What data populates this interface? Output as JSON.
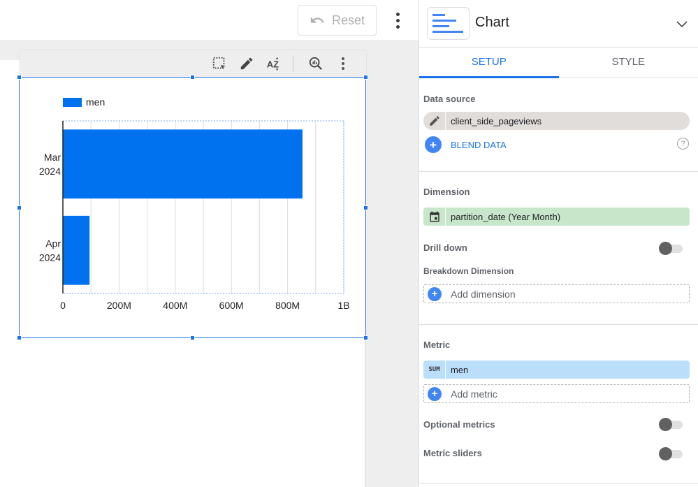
{
  "topbar": {
    "reset_label": "Reset"
  },
  "chart_toolbar": {
    "icons": [
      "select-region-icon",
      "edit-icon",
      "sort-az-icon",
      "explore-chart-icon",
      "more-vert-icon"
    ]
  },
  "chart_data": {
    "type": "bar",
    "orientation": "horizontal",
    "categories": [
      "Mar 2024",
      "Apr 2024"
    ],
    "category_lines": [
      [
        "Mar",
        "2024"
      ],
      [
        "Apr",
        "2024"
      ]
    ],
    "series": [
      {
        "name": "men",
        "values": [
          853000000,
          95000000
        ],
        "color": "#0072ef"
      }
    ],
    "legend": {
      "entries": [
        "men"
      ],
      "position": "top-left"
    },
    "xlim": [
      0,
      1000000000
    ],
    "x_ticks": [
      0,
      200000000,
      400000000,
      600000000,
      800000000,
      1000000000
    ],
    "x_tick_labels": [
      "0",
      "200M",
      "400M",
      "600M",
      "800M",
      "1B"
    ],
    "gridline_step": 100000000,
    "grid": true,
    "title": "",
    "xlabel": "",
    "ylabel": ""
  },
  "panel": {
    "title": "Chart",
    "tabs": [
      {
        "label": "SETUP",
        "active": true
      },
      {
        "label": "STYLE",
        "active": false
      }
    ],
    "data_source": {
      "label": "Data source",
      "value": "client_side_pageviews",
      "blend_label": "BLEND DATA",
      "help_glyph": "?"
    },
    "dimension": {
      "label": "Dimension",
      "value": "partition_date (Year Month)",
      "drill_down_label": "Drill down",
      "drill_down_on": false,
      "breakdown_label": "Breakdown Dimension",
      "add_label": "Add dimension"
    },
    "metric": {
      "label": "Metric",
      "aggregation": "SUM",
      "value": "men",
      "add_label": "Add metric",
      "optional_metrics_label": "Optional metrics",
      "optional_metrics_on": false,
      "metric_sliders_label": "Metric sliders",
      "metric_sliders_on": false
    },
    "plus_glyph": "+"
  }
}
